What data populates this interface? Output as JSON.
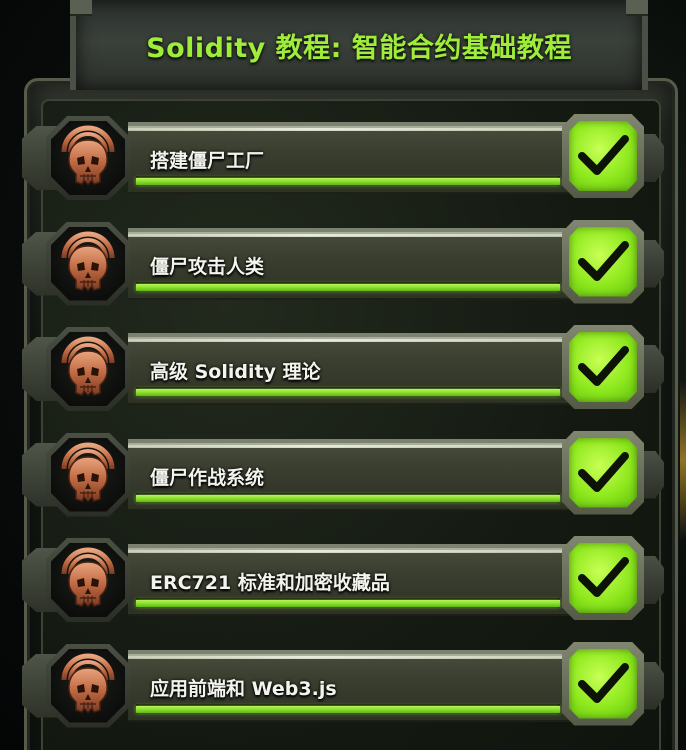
{
  "header": {
    "title": "Solidity 教程: 智能合约基础教程"
  },
  "lessons": [
    {
      "label": "搭建僵尸工厂",
      "progress": 1.0,
      "completed": true
    },
    {
      "label": "僵尸攻击人类",
      "progress": 1.0,
      "completed": true
    },
    {
      "label": "高级 Solidity 理论",
      "progress": 1.0,
      "completed": true
    },
    {
      "label": "僵尸作战系统",
      "progress": 1.0,
      "completed": true
    },
    {
      "label": "ERC721 标准和加密收藏品",
      "progress": 1.0,
      "completed": true
    },
    {
      "label": "应用前端和 Web3.js",
      "progress": 1.0,
      "completed": true
    }
  ],
  "icons": {
    "lesson_badge": "skull-icon",
    "completed": "checkmark-icon"
  },
  "colors": {
    "accent_green": "#9fec3b",
    "progress_green": "#8adf2c",
    "label_text": "#f4f4ee"
  }
}
